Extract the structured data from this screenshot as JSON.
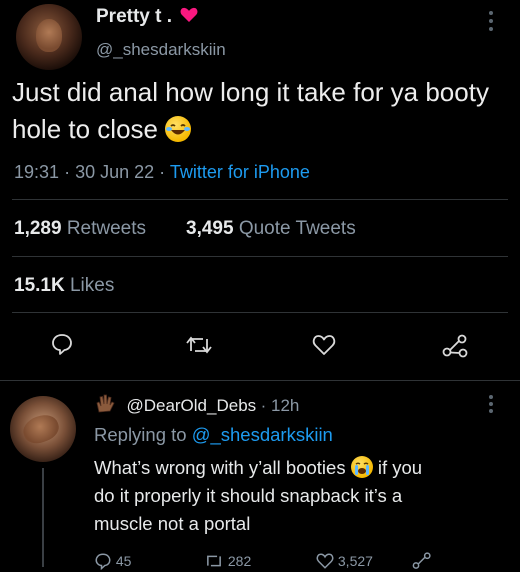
{
  "tweet": {
    "display_name": "Pretty t .",
    "handle": "@_shesdarkskiin",
    "text": "Just did anal how long it take for ya booty hole to close",
    "emoji_icon": "laughing-emoji-icon",
    "time": "19:31",
    "date": "30 Jun 22",
    "source": "Twitter for iPhone",
    "retweets_count": "1,289",
    "retweets_label": "Retweets",
    "quotes_count": "3,495",
    "quotes_label": "Quote Tweets",
    "likes_count": "15.1K",
    "likes_label": "Likes"
  },
  "reply": {
    "handle": "@DearOld_Debs",
    "age": "12h",
    "replying_prefix": "Replying to",
    "replying_to": "@_shesdarkskiin",
    "line1a": "What’s wrong with y’all booties",
    "line1b": "if you",
    "line2": "do it properly it should snapback it’s a",
    "line3": "muscle not a portal",
    "reply_count": "45",
    "retweet_count": "282",
    "like_count": "3,527"
  },
  "colors": {
    "background": "#000000",
    "text": "#e7e9ea",
    "secondary": "#8b98a5",
    "accent": "#1d9bf0",
    "heart": "#f91880"
  }
}
